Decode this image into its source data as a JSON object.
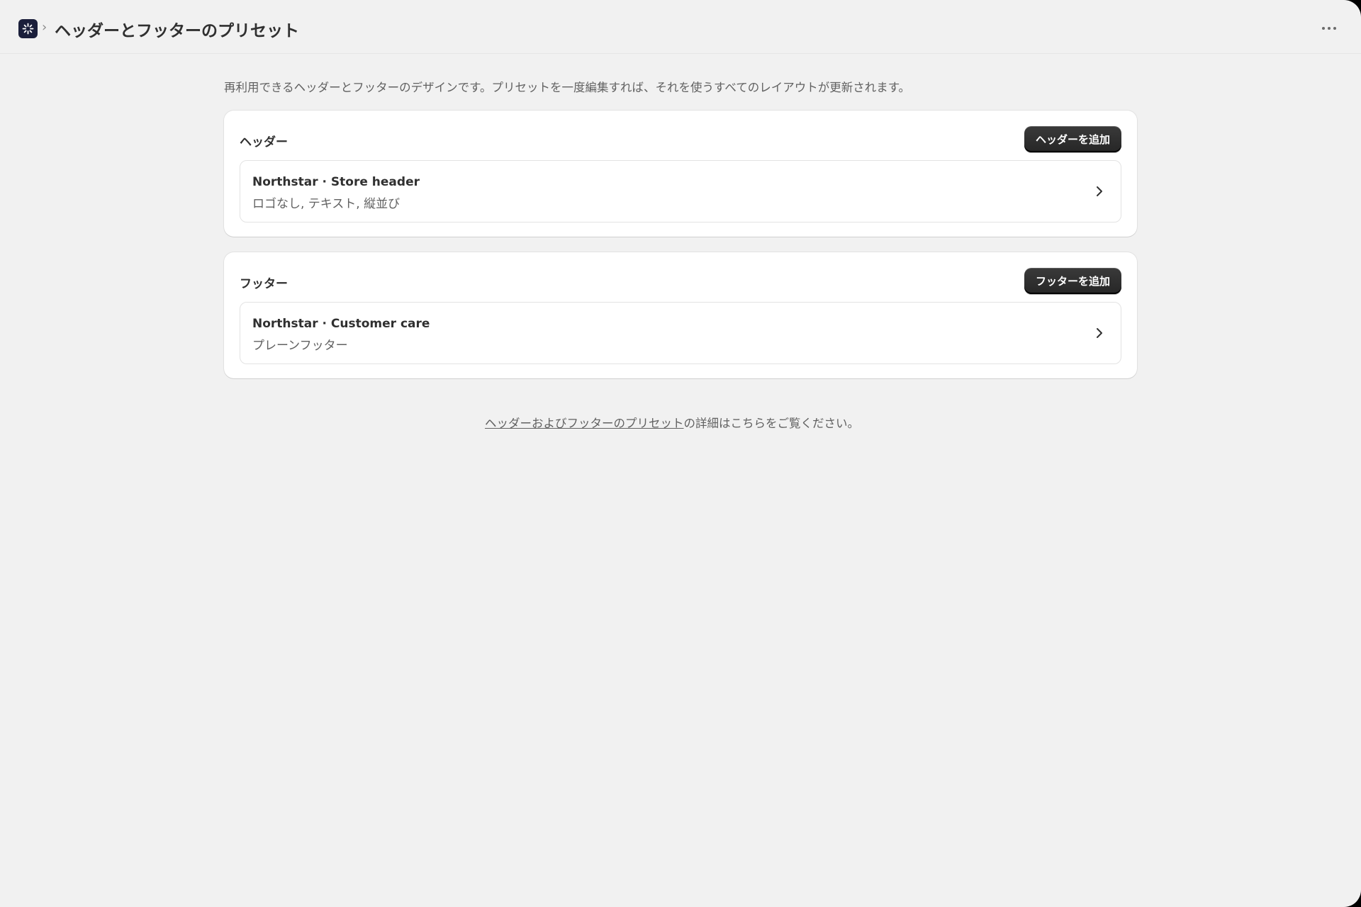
{
  "topbar": {
    "app_icon": "sparkle-app-icon",
    "separator": "›",
    "title": "ヘッダーとフッターのプリセット",
    "more_icon": "ellipsis-icon"
  },
  "main": {
    "description": "再利用できるヘッダーとフッターのデザインです。プリセットを一度編集すれば、それを使うすべてのレイアウトが更新されます。",
    "header_card": {
      "title": "ヘッダー",
      "add_button": "ヘッダーを追加",
      "presets": [
        {
          "name": "Northstar · Store header",
          "detail": "ロゴなし, テキスト, 縦並び"
        }
      ]
    },
    "footer_card": {
      "title": "フッター",
      "add_button": "フッターを追加",
      "presets": [
        {
          "name": "Northstar · Customer care",
          "detail": "プレーンフッター"
        }
      ]
    },
    "help": {
      "link_text": "ヘッダーおよびフッターのプリセット",
      "suffix": "の詳細はこちらをご覧ください。"
    }
  },
  "colors": {
    "background": "#f1f1f1",
    "card": "#ffffff",
    "primary_button": "#303030",
    "app_icon": "#1b1f3b"
  }
}
